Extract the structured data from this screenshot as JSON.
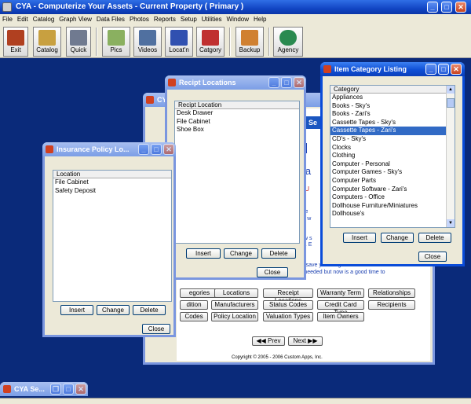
{
  "app": {
    "title": "CYA  - Computerize Your Assets -  Current Property ( Primary )",
    "minimized_title": "CYA Se..."
  },
  "menu": [
    "File",
    "Edit",
    "Catalog",
    "Graph View",
    "Data Files",
    "Photos",
    "Reports",
    "Setup",
    "Utilities",
    "Window",
    "Help"
  ],
  "toolbar": {
    "exit": "Exit",
    "catalog": "Catalog",
    "quick": "Quick",
    "pics": "Pics",
    "videos": "Videos",
    "locatn": "Locat'n",
    "catgory": "Catgory",
    "backup": "Backup",
    "agency": "Agency"
  },
  "bg_page": {
    "fragments": [
      "u",
      "Ma",
      "ETU",
      "vible",
      "you w",
      "New s",
      "st it. E",
      "will save you a significant amo",
      "as needed but now is a good time to"
    ],
    "buttons": [
      "egories",
      "Locations",
      "Receipt Locations",
      "Warranty Term",
      "Relationships",
      "dition",
      "Manufacturers",
      "Status Codes",
      "Credit Card Type",
      "Recipients",
      "Codes",
      "Policy Location",
      "Valuation Types",
      "Item Owners"
    ],
    "prev": "Prev",
    "next": "Next",
    "copyright": "Copyright ©  2005 - 2006   Custom Apps, Inc.",
    "cya": "CYA",
    "se": "Se"
  },
  "receipt": {
    "title": "Recipt Locations",
    "header": "Recipt Location",
    "items": [
      "Desk Drawer",
      "File Cabinet",
      "Shoe Box"
    ],
    "insert": "Insert",
    "change": "Change",
    "delete": "Delete",
    "close": "Close"
  },
  "insurance": {
    "title": "Insurance Policy Lo...",
    "header": "Location",
    "items": [
      "File Cabinet",
      "Safety Deposit"
    ],
    "insert": "Insert",
    "change": "Change",
    "delete": "Delete",
    "close": "Close"
  },
  "category": {
    "title": "Item Category Listing",
    "header": "Category",
    "items": [
      "Appliances",
      "Books - Sky's",
      "Books - Zari's",
      "Cassette Tapes - Sky's",
      "Cassette Tapes - Zari's",
      "CD's - Sky's",
      "Clocks",
      "Clothing",
      "Computer - Personal",
      "Computer Games - Sky's",
      "Computer Parts",
      "Computer Software - Zari's",
      "Computers - Office",
      "Dollhouse Furniture/Miniatures",
      "Dollhouse's"
    ],
    "selected": "Cassette Tapes - Zari's",
    "insert": "Insert",
    "change": "Change",
    "delete": "Delete",
    "close": "Close"
  },
  "colors": {
    "title_blue": "#0f4fd6",
    "desktop": "#0a2a7a",
    "selection": "#316ac5"
  }
}
